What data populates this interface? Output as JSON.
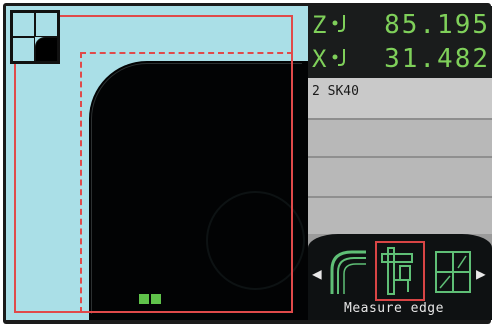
{
  "readout": {
    "z": {
      "axis": "Z",
      "icon": "tool-axis-icon",
      "value": "85.195"
    },
    "x": {
      "axis": "X",
      "icon": "tool-axis-icon",
      "value": "31.482"
    }
  },
  "tool": {
    "label": "2 SK40"
  },
  "menu": {
    "items": [
      {
        "name": "edge-contour-icon"
      },
      {
        "name": "measure-edge-icon",
        "selected": true
      },
      {
        "name": "grid-measure-icon"
      }
    ],
    "label": "Measure edge"
  },
  "colors": {
    "background": "#aadfe7",
    "guide": "#e04a4a",
    "readout": "#7fd05a",
    "marker": "#5fc24a"
  }
}
